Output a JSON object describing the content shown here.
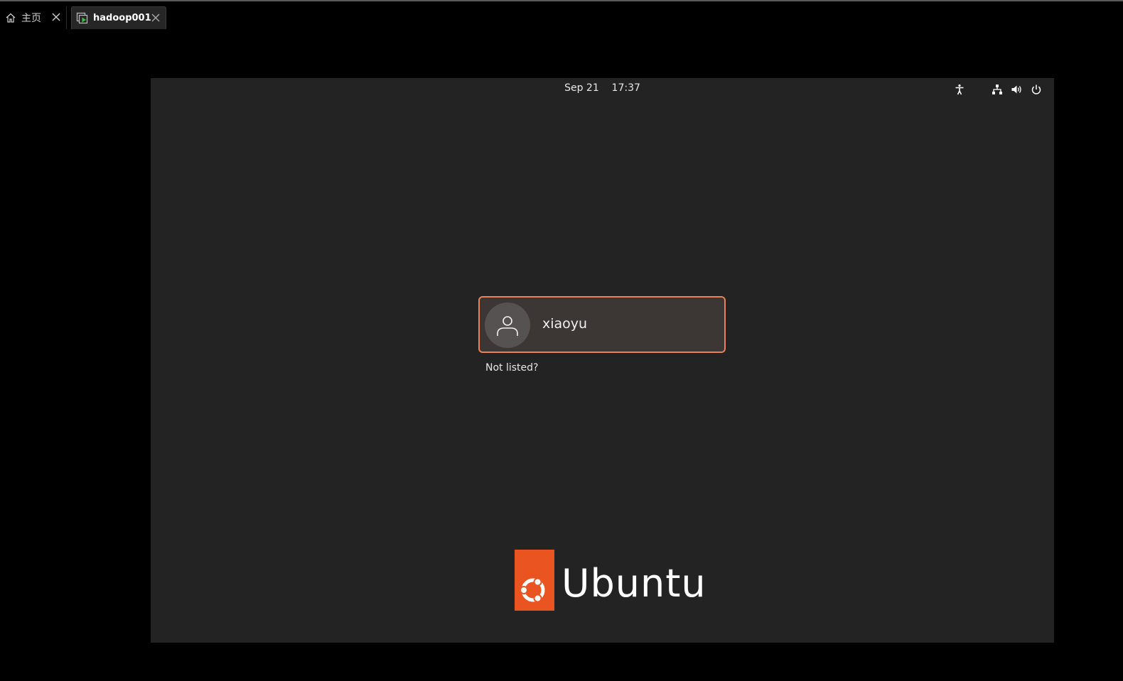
{
  "tabs": [
    {
      "label": "主页",
      "icon": "home-icon"
    },
    {
      "label": "hadoop001",
      "icon": "vm-running-icon"
    }
  ],
  "login_screen": {
    "date": "Sep 21",
    "time": "17:37",
    "status_icons": [
      "accessibility-icon",
      "network-icon",
      "volume-icon",
      "power-icon"
    ],
    "user": {
      "name": "xiaoyu",
      "avatar_icon": "user-icon"
    },
    "not_listed": "Not listed?",
    "brand": "Ubuntu"
  },
  "colors": {
    "accent": "#e9825b",
    "ubuntu_orange": "#e95420",
    "background": "#232323"
  }
}
